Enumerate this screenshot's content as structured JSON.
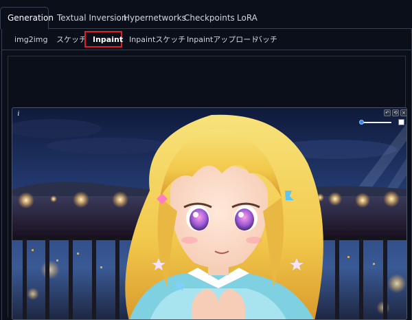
{
  "top_tabs": [
    {
      "label": "Generation",
      "active": true
    },
    {
      "label": "Textual Inversion",
      "active": false
    },
    {
      "label": "Hypernetworks",
      "active": false
    },
    {
      "label": "Checkpoints",
      "active": false
    },
    {
      "label": "LoRA",
      "active": false
    }
  ],
  "sub_tabs": [
    {
      "label": "img2img",
      "active": false
    },
    {
      "label": "スケッチ",
      "active": false
    },
    {
      "label": "Inpaint",
      "active": true
    },
    {
      "label": "Inpaintスケッチ",
      "active": false
    },
    {
      "label": "Inpaintアップロード",
      "active": false
    },
    {
      "label": "バッチ",
      "active": false
    }
  ],
  "image_editor": {
    "info_icon": "i",
    "tools": [
      "undo-icon",
      "clear-icon",
      "close-icon"
    ],
    "brush_size": 0.05,
    "brush_color": "#ffffff",
    "highlight_color": "#e11d2a"
  }
}
